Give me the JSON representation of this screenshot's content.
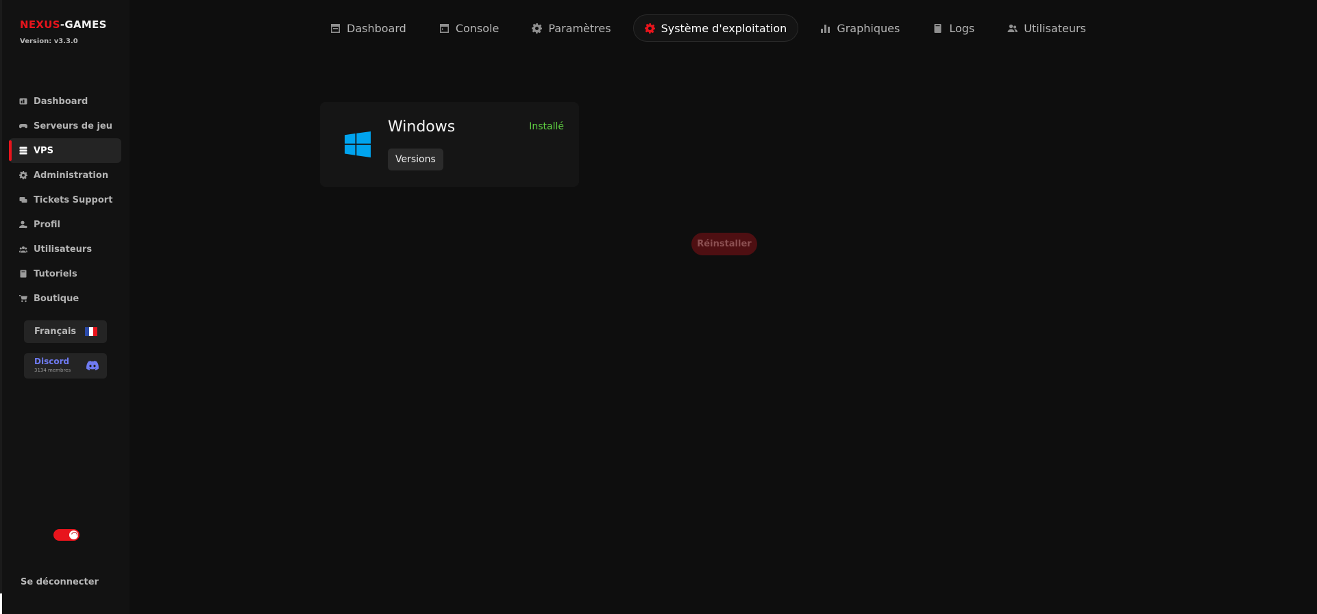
{
  "brand": {
    "part1": "NEXUS",
    "part2": "-GAMES",
    "version": "Version: v3.3.0"
  },
  "sidebar": {
    "items": [
      {
        "label": "Dashboard",
        "icon": "dashboard-icon"
      },
      {
        "label": "Serveurs de jeu",
        "icon": "gamepad-icon"
      },
      {
        "label": "VPS",
        "icon": "server-icon",
        "active": true
      },
      {
        "label": "Administration",
        "icon": "gear-icon"
      },
      {
        "label": "Tickets Support",
        "icon": "ticket-icon"
      },
      {
        "label": "Profil",
        "icon": "user-icon"
      },
      {
        "label": "Utilisateurs",
        "icon": "users-icon"
      },
      {
        "label": "Tutoriels",
        "icon": "book-icon"
      },
      {
        "label": "Boutique",
        "icon": "cart-icon"
      }
    ],
    "language": "Français",
    "discord": {
      "label": "Discord",
      "members": "3134 membres"
    },
    "logout": "Se déconnecter"
  },
  "tabs": [
    {
      "label": "Dashboard",
      "icon": "panel-icon"
    },
    {
      "label": "Console",
      "icon": "console-icon"
    },
    {
      "label": "Paramètres",
      "icon": "gear-icon"
    },
    {
      "label": "Système d'exploitation",
      "icon": "gear-icon",
      "active": true
    },
    {
      "label": "Graphiques",
      "icon": "bar-chart-icon"
    },
    {
      "label": "Logs",
      "icon": "book-icon"
    },
    {
      "label": "Utilisateurs",
      "icon": "users-icon"
    }
  ],
  "os": {
    "name": "Windows",
    "status": "Installé",
    "versions_label": "Versions"
  },
  "reinstall_label": "Réinstaller",
  "colors": {
    "accent": "#e8141c",
    "installed": "#5fd042",
    "discord": "#6f7bf2",
    "windows": "#00a4ef"
  }
}
